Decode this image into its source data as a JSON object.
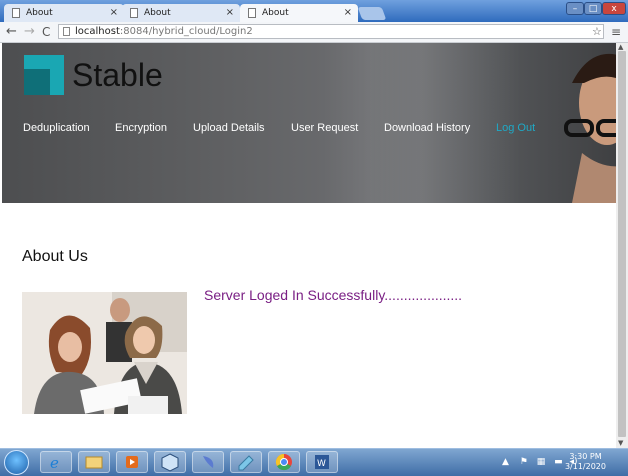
{
  "browser": {
    "tabs": [
      {
        "title": "About"
      },
      {
        "title": "About"
      },
      {
        "title": "About"
      }
    ],
    "url_host": "localhost",
    "url_path": ":8084/hybrid_cloud/Login2",
    "window_controls": {
      "minimize": "–",
      "maximize": "□",
      "close": "x"
    }
  },
  "site": {
    "brand": "Stable",
    "nav": [
      {
        "label": "Deduplication"
      },
      {
        "label": "Encryption"
      },
      {
        "label": "Upload Details"
      },
      {
        "label": "User Request"
      },
      {
        "label": "Download History"
      },
      {
        "label": "Log Out",
        "active": true
      }
    ]
  },
  "content": {
    "heading": "About Us",
    "message": "Server Loged In Successfully...................."
  },
  "taskbar": {
    "time": "3:30 PM",
    "date": "3/11/2020"
  },
  "colors": {
    "accent": "#1fa9c6",
    "message": "#7a1f84",
    "logo_teal": "#1a8f98"
  }
}
